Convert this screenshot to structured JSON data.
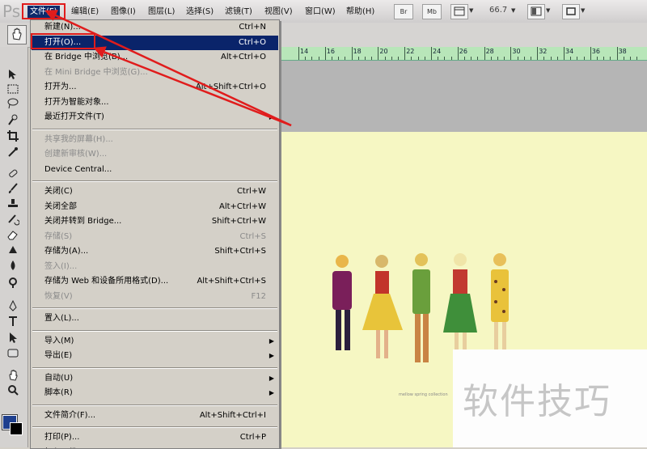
{
  "app": {
    "logo_text": "Ps"
  },
  "menubar": {
    "items": [
      "文件(F)",
      "编辑(E)",
      "图像(I)",
      "图层(L)",
      "选择(S)",
      "滤镜(T)",
      "视图(V)",
      "窗口(W)",
      "帮助(H)"
    ],
    "active_index": 0,
    "toolbar_buttons": [
      "Br",
      "Mb"
    ],
    "zoom": "66.7"
  },
  "file_menu": {
    "items": [
      {
        "label": "新建(N)...",
        "shortcut": "Ctrl+N",
        "enabled": true
      },
      {
        "label": "打开(O)...",
        "shortcut": "Ctrl+O",
        "enabled": true,
        "selected": true
      },
      {
        "label": "在 Bridge 中浏览(B)...",
        "shortcut": "Alt+Ctrl+O",
        "enabled": true
      },
      {
        "label": "在 Mini Bridge 中浏览(G)...",
        "shortcut": "",
        "enabled": false
      },
      {
        "label": "打开为...",
        "shortcut": "Alt+Shift+Ctrl+O",
        "enabled": true
      },
      {
        "label": "打开为智能对象...",
        "shortcut": "",
        "enabled": true
      },
      {
        "label": "最近打开文件(T)",
        "shortcut": "",
        "enabled": true,
        "submenu": true
      },
      {
        "separator": true
      },
      {
        "label": "共享我的屏幕(H)...",
        "shortcut": "",
        "enabled": false
      },
      {
        "label": "创建新审核(W)...",
        "shortcut": "",
        "enabled": false
      },
      {
        "label": "Device Central...",
        "shortcut": "",
        "enabled": true
      },
      {
        "separator": true
      },
      {
        "label": "关闭(C)",
        "shortcut": "Ctrl+W",
        "enabled": true
      },
      {
        "label": "关闭全部",
        "shortcut": "Alt+Ctrl+W",
        "enabled": true
      },
      {
        "label": "关闭并转到 Bridge...",
        "shortcut": "Shift+Ctrl+W",
        "enabled": true
      },
      {
        "label": "存储(S)",
        "shortcut": "Ctrl+S",
        "enabled": false
      },
      {
        "label": "存储为(A)...",
        "shortcut": "Shift+Ctrl+S",
        "enabled": true
      },
      {
        "label": "签入(I)...",
        "shortcut": "",
        "enabled": false
      },
      {
        "label": "存储为 Web 和设备所用格式(D)...",
        "shortcut": "Alt+Shift+Ctrl+S",
        "enabled": true
      },
      {
        "label": "恢复(V)",
        "shortcut": "F12",
        "enabled": false
      },
      {
        "separator": true
      },
      {
        "label": "置入(L)...",
        "shortcut": "",
        "enabled": true
      },
      {
        "separator": true
      },
      {
        "label": "导入(M)",
        "shortcut": "",
        "enabled": true,
        "submenu": true
      },
      {
        "label": "导出(E)",
        "shortcut": "",
        "enabled": true,
        "submenu": true
      },
      {
        "separator": true
      },
      {
        "label": "自动(U)",
        "shortcut": "",
        "enabled": true,
        "submenu": true
      },
      {
        "label": "脚本(R)",
        "shortcut": "",
        "enabled": true,
        "submenu": true
      },
      {
        "separator": true
      },
      {
        "label": "文件简介(F)...",
        "shortcut": "Alt+Shift+Ctrl+I",
        "enabled": true
      },
      {
        "separator": true
      },
      {
        "label": "打印(P)...",
        "shortcut": "Ctrl+P",
        "enabled": true
      },
      {
        "label": "打印一份(Y)",
        "shortcut": "Alt+Shift+Ctrl+P",
        "enabled": true
      }
    ]
  },
  "ruler": {
    "labels": [
      "14",
      "16",
      "18",
      "20",
      "22",
      "24",
      "26",
      "28",
      "30",
      "32",
      "34",
      "36",
      "38"
    ]
  },
  "canvas": {
    "caption": "mellow spring collection",
    "colors": {
      "background": "#f6f7c3",
      "ruler": "#b8e6b9",
      "highlight": "#e01c1c",
      "selection": "#0a246a"
    }
  },
  "watermark": {
    "text": "软件技巧"
  },
  "toolbox": {
    "icons": [
      "move-icon",
      "marquee-icon",
      "lasso-icon",
      "quick-select-icon",
      "crop-icon",
      "eyedropper-icon",
      "healing-brush-icon",
      "brush-icon",
      "clone-stamp-icon",
      "history-brush-icon",
      "eraser-icon",
      "gradient-icon",
      "blur-icon",
      "dodge-icon",
      "pen-icon",
      "type-icon",
      "path-select-icon",
      "shape-icon",
      "hand-icon",
      "zoom-icon"
    ]
  }
}
